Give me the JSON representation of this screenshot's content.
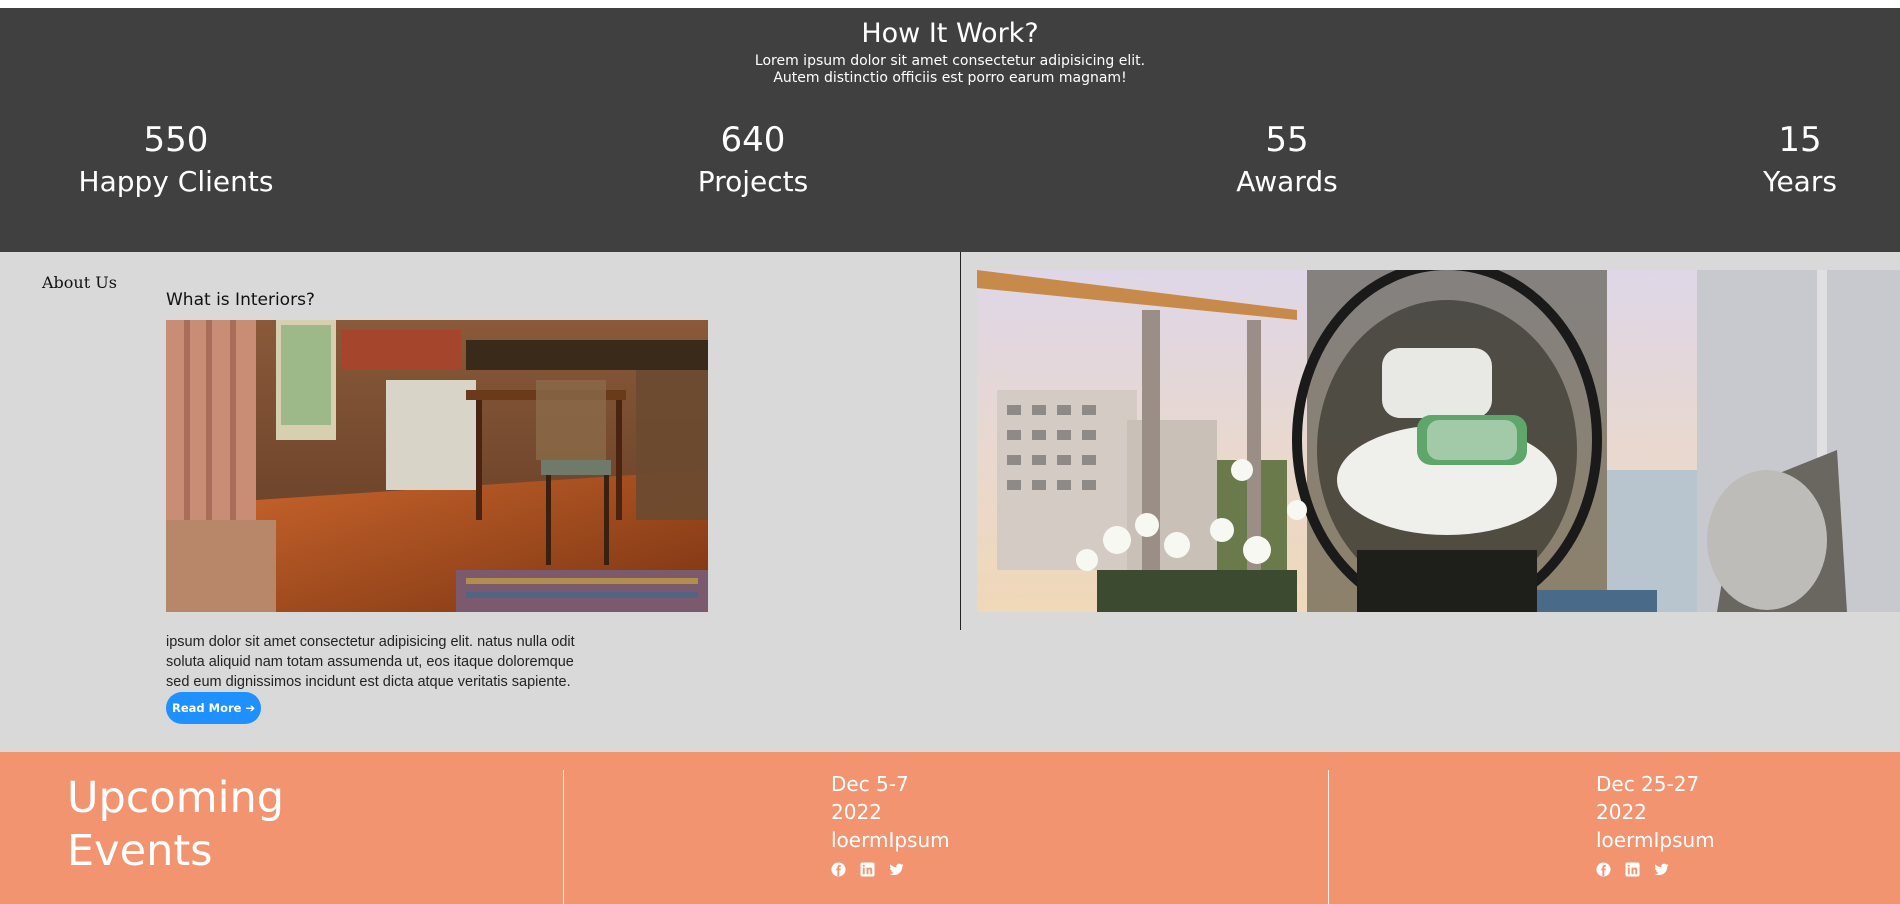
{
  "how_it_works": {
    "title": "How It Work?",
    "desc_line1": "Lorem ipsum dolor sit amet consectetur adipisicing elit.",
    "desc_line2": "Autem distinctio officiis est porro earum magnam!",
    "stats": [
      {
        "number": "550",
        "label": "Happy Clients"
      },
      {
        "number": "640",
        "label": "Projects"
      },
      {
        "number": "55",
        "label": "Awards"
      },
      {
        "number": "15",
        "label": "Years"
      }
    ]
  },
  "about": {
    "heading": "About Us",
    "question": "What is Interiors?",
    "body": "ipsum dolor sit amet consectetur adipisicing elit. natus nulla odit soluta aliquid nam totam assumenda ut, eos itaque doloremque sed eum dignissimos incidunt est dicta atque veritatis sapiente.",
    "read_more": "Read More"
  },
  "events": {
    "title_line1": "Upcoming",
    "title_line2": "Events",
    "items": [
      {
        "dates": "Dec 5-7",
        "year": "2022",
        "name": "loermIpsum"
      },
      {
        "dates": "Dec 25-27",
        "year": "2022",
        "name": "loermIpsum"
      }
    ],
    "social_icons": [
      "facebook-icon",
      "linkedin-icon",
      "twitter-icon"
    ]
  },
  "colors": {
    "dark_band": "#404040",
    "about_bg": "#d9d9d9",
    "events_bg": "#f29470",
    "button": "#1e90ff"
  }
}
